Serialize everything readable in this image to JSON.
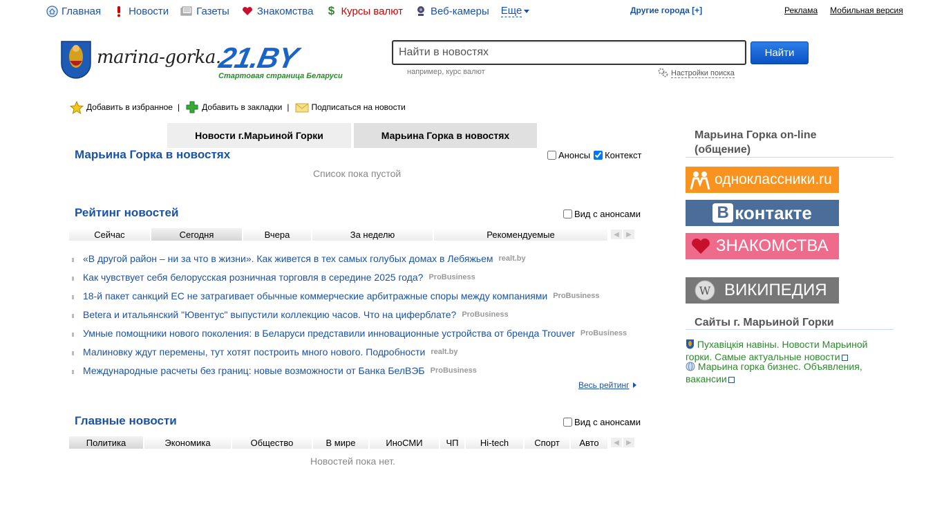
{
  "topnav": {
    "items": [
      {
        "label": "Главная",
        "icon": "home-icon"
      },
      {
        "label": "Новости",
        "icon": "exclamation-icon"
      },
      {
        "label": "Газеты",
        "icon": "newspaper-icon"
      },
      {
        "label": "Знакомства",
        "icon": "heart-icon"
      },
      {
        "label": "Курсы валют",
        "icon": "dollar-icon"
      },
      {
        "label": "Веб-камеры",
        "icon": "webcam-icon"
      }
    ],
    "more": "Еще",
    "other_cities": "Другие города [+]",
    "ads": "Реклама",
    "mobile": "Мобильная версия"
  },
  "logo": {
    "city_text": "marina-gorka.",
    "brand": "21.BY",
    "slogan": "Стартовая страница Беларуси"
  },
  "search": {
    "placeholder": "Найти в новостях",
    "button": "Найти",
    "example": "например, курс валют",
    "settings": "Настройки поиска"
  },
  "actions": {
    "favorite": "Добавить в избранное",
    "bookmarks": "Добавить в закладки",
    "subscribe": "Подписаться на новости"
  },
  "tabs": {
    "local_news": "Новости г.Марьиной Горки",
    "in_news": "Марьина Горка в новостях"
  },
  "in_news_section": {
    "title": "Марьина Горка в новостях",
    "announces": "Анонсы",
    "context": "Контекст",
    "empty": "Список пока пустой"
  },
  "rating": {
    "title": "Рейтинг новостей",
    "with_announces": "Вид с анонсами",
    "tabs": [
      "Сейчас",
      "Сегодня",
      "Вчера",
      "За неделю",
      "Рекомендуемые"
    ],
    "active_tab": "Сегодня",
    "items": [
      {
        "title": "«В другой район – ни за что в жизни». Как живется в тех самых голубых домах в Лебяжьем",
        "source": "realt.by"
      },
      {
        "title": "Как чувствует себя белорусская розничная торговля в середине 2025 года?",
        "source": "ProBusiness"
      },
      {
        "title": "18-й пакет санкций ЕС не затрагивает обычные коммерческие арбитражные споры между компаниями",
        "source": "ProBusiness"
      },
      {
        "title": "Betera и итальянский \"Ювентус\" выпустили коллекцию часов. Что на циферблате?",
        "source": "ProBusiness"
      },
      {
        "title": "Умные помощники нового поколения: в Беларуси представили инновационные устройства от бренда Trouver",
        "source": "ProBusiness"
      },
      {
        "title": "Малиновку ждут перемены, тут хотят построить много нового. Подробности",
        "source": "realt.by"
      },
      {
        "title": "Международные расчеты без границ: новые возможности от Банка БелВЭБ",
        "source": "ProBusiness"
      }
    ],
    "all": "Весь рейтинг"
  },
  "main_news": {
    "title": "Главные новости",
    "with_announces": "Вид с анонсами",
    "tabs": [
      "Политика",
      "Экономика",
      "Общество",
      "В мире",
      "ИноСМИ",
      "ЧП",
      "Hi-tech",
      "Спорт",
      "Авто"
    ],
    "active_tab": "Политика",
    "empty": "Новостей пока нет."
  },
  "right": {
    "online_title": "Марьина Горка on-line (общение)",
    "banners": [
      {
        "label": "одноклассники.ru",
        "icon": "odnoklassniki-icon",
        "color": "#f7931e"
      },
      {
        "label": "контакте",
        "prefix": "В",
        "icon": "vk-icon",
        "color": "#4a6e99"
      },
      {
        "label": "ЗНАКОМСТВА",
        "icon": "heart-icon",
        "color": "#ee6b8c"
      },
      {
        "label": "ВИКИПЕДИЯ",
        "icon": "wikipedia-icon",
        "color": "#777777"
      }
    ],
    "sites_title": "Сайты г. Марьиной Горки",
    "sites": [
      {
        "label": "Пухавіцкія навіны. Новости Марьиной горки. Самые актуальные новости",
        "icon": "crest-icon"
      },
      {
        "label": "Марьина горка бизнес. Объявления, вакансии",
        "icon": "globe-icon"
      }
    ]
  },
  "colors": {
    "link": "#1a52a8",
    "accent_green": "#2a8a2a",
    "currency_red": "#d40000"
  }
}
